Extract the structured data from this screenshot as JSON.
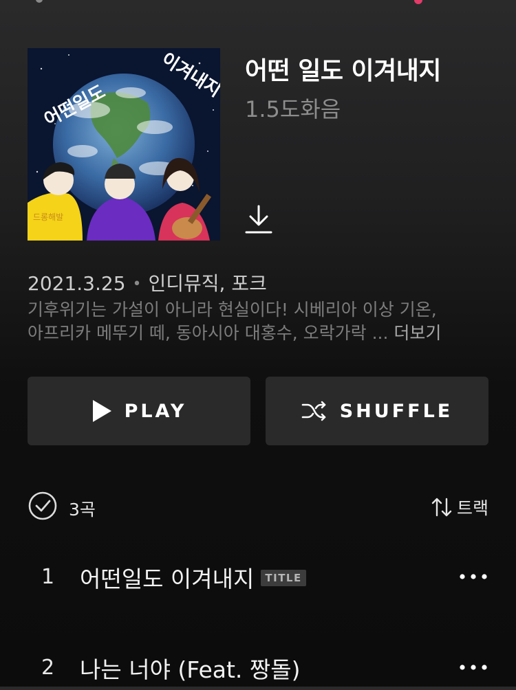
{
  "album": {
    "title": "어떤 일도 이겨내지",
    "artist": "1.5도화음",
    "cover_text_left": "어떤일도",
    "cover_text_right": "이겨내지",
    "cover_sign": "드롱해발"
  },
  "meta": {
    "date": "2021.3.25",
    "separator": "•",
    "genres": "인디뮤직,  포크"
  },
  "description": {
    "line1": "기후위기는 가설이 아니라 현실이다! 시베리아 이상 기온,",
    "line2": "아프리카 메뚜기 떼, 동아시아 대홍수, 오락가락 ... ",
    "more": "더보기"
  },
  "buttons": {
    "play": "PLAY",
    "shuffle": "SHUFFLE"
  },
  "tracklist": {
    "count": "3곡",
    "sort_label": "트랙"
  },
  "tracks": [
    {
      "number": "1",
      "title": "어떤일도 이겨내지",
      "badge": "TITLE"
    },
    {
      "number": "2",
      "title": "나는 너야 (Feat. 짱돌)"
    }
  ],
  "colors": {
    "accent": "#e23b6a",
    "button_bg": "#2a2a2a",
    "muted_text": "#7d7d7d"
  },
  "icons": [
    "download-icon",
    "play-icon",
    "shuffle-icon",
    "check-circle-icon",
    "sort-icon",
    "more-icon"
  ]
}
